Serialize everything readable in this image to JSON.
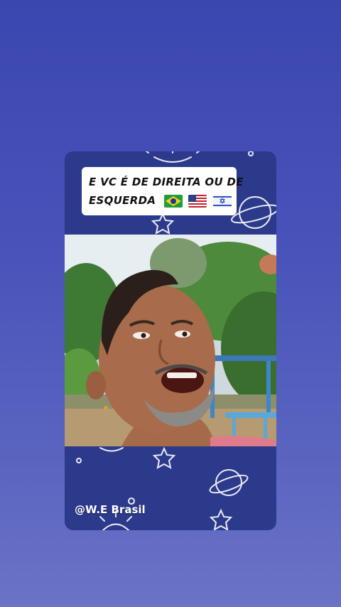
{
  "post": {
    "caption_line1": "E VC É  DE DIREITA OU DE",
    "caption_line2": "ESQUERDA",
    "flags": [
      "brazil-flag-icon",
      "usa-flag-icon",
      "israel-flag-icon"
    ],
    "handle": "@W.E Brasil"
  },
  "colors": {
    "background_top": "#3b47b0",
    "background_bottom": "#6b73c6",
    "card": "#2c3a8c",
    "caption_box": "#ffffff"
  }
}
